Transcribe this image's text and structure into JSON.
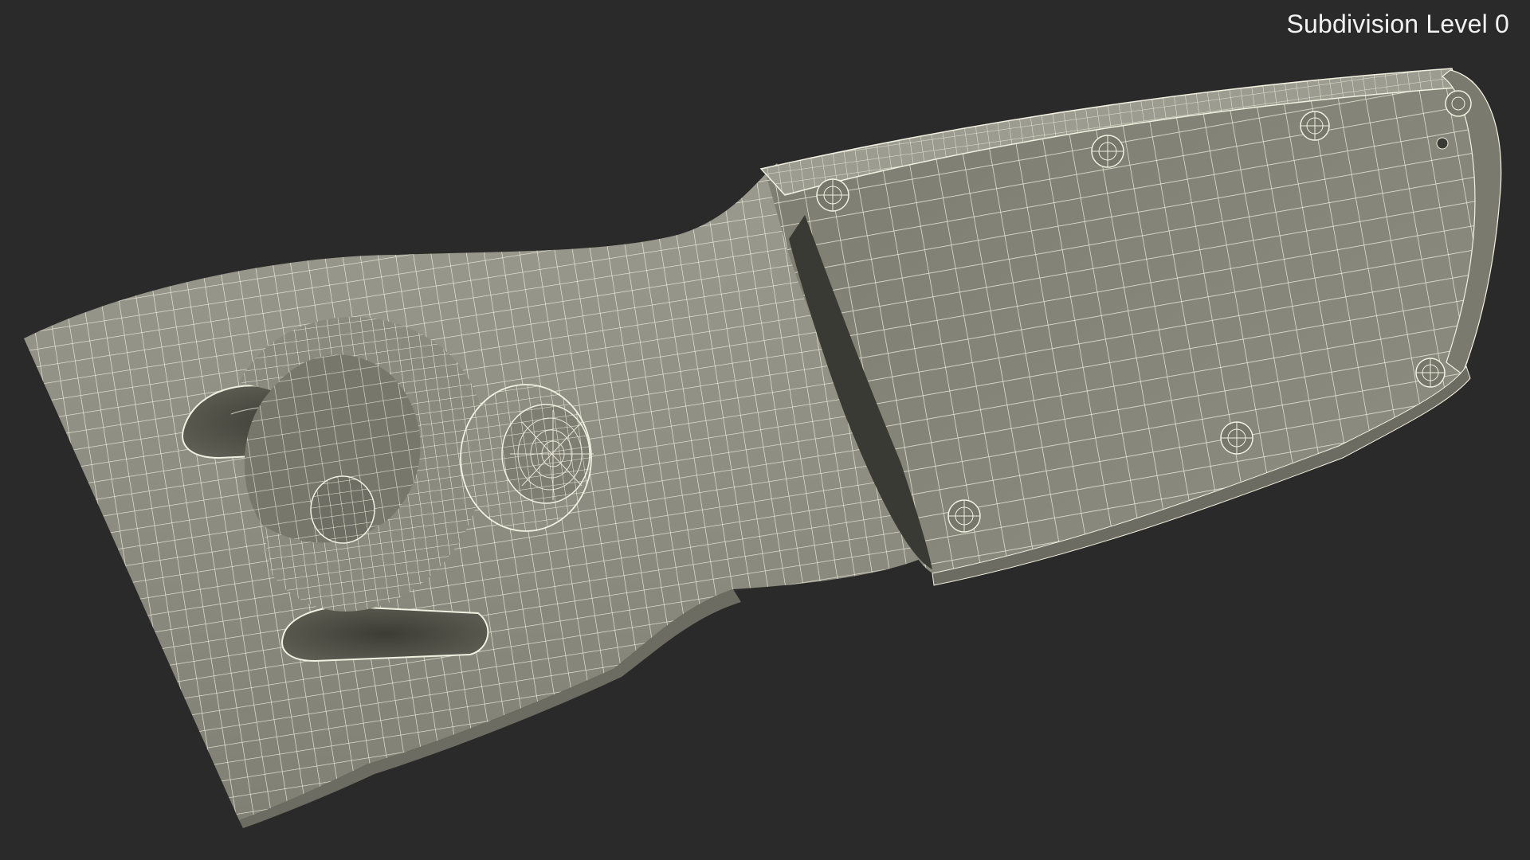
{
  "viewport": {
    "label": "Subdivision Level 0",
    "background_color": "#2a2a2a",
    "mesh_fill_color": "#8c8b80",
    "mesh_shadow_color": "#55554c",
    "wire_color": "#f2f0e0"
  },
  "model": {
    "description_visible": "",
    "render_style": "wireframe-over-shaded"
  }
}
